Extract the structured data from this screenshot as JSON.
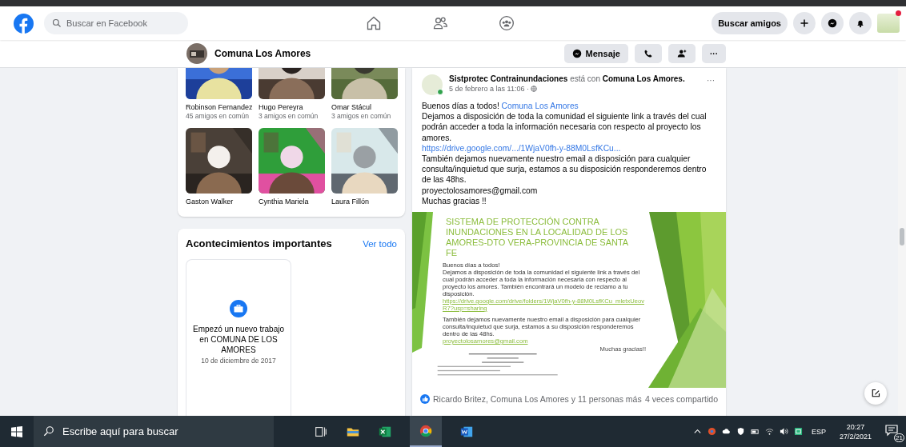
{
  "header": {
    "search_placeholder": "Buscar en Facebook",
    "find_friends": "Buscar amigos"
  },
  "page_bar": {
    "name": "Comuna Los Amores",
    "message": "Mensaje",
    "more": "···"
  },
  "friends": [
    {
      "name": "Robinson Fernandez",
      "mutual": "45 amigos en común"
    },
    {
      "name": "Hugo Pereyra",
      "mutual": "3 amigos en común"
    },
    {
      "name": "Omar Stácul",
      "mutual": "3 amigos en común"
    },
    {
      "name": "Gaston Walker"
    },
    {
      "name": "Cynthia Mariela"
    },
    {
      "name": "Laura Fillón"
    }
  ],
  "events": {
    "title": "Acontecimientos importantes",
    "see_all": "Ver todo",
    "items": [
      {
        "text": "Empezó un nuevo trabajo en COMUNA DE LOS AMORES",
        "date": "10 de diciembre de 2017"
      }
    ]
  },
  "post": {
    "author": "Sistprotec Contrainundaciones",
    "with": "está con",
    "tagged": "Comuna Los Amores.",
    "time": "5 de febrero a las 11:06 ·",
    "more": "···",
    "body": [
      {
        "kind": "mention",
        "text": "Buenos días a todos!",
        "link": "Comuna Los Amores"
      },
      {
        "kind": "text",
        "text": "Dejamos a disposición de toda la comunidad el siguiente link a través del cual podrán acceder a toda la información necesaria con respecto al proyecto los amores."
      },
      {
        "kind": "link",
        "text": "https://drive.google.com/.../1WjaV0fh-y-88M0LsfKCu..."
      },
      {
        "kind": "text",
        "text": "También dejamos nuevamente nuestro email a disposición para cualquier consulta/inquietud que surja, estamos a su disposición responderemos dentro de las 48hs."
      },
      {
        "kind": "text",
        "text": "proyectolosamores@gmail.com"
      },
      {
        "kind": "text",
        "text": "Muchas gracias !!"
      }
    ],
    "slide": {
      "title": "SISTEMA DE PROTECCIÓN CONTRA INUNDACIONES EN LA LOCALIDAD DE LOS AMORES-DTO VERA-PROVINCIA DE SANTA FE",
      "greeting": "Buenos días a todos!",
      "paragraph": "Dejamos a disposición de toda la comunidad el siguiente link a través del cual podrán acceder a toda la información necesaria con respecto al proyecto los amores. También encontrará un modelo de reclamo a tu disposición.",
      "link": "https://drive.google.com/drive/folders/1WjaV0fh-y-88M0LsfKCu_mletxUeovR7?usp=sharing",
      "paragraph_2": "También dejamos nuevamente nuestro email a disposición para cualquier consulta/inquietud que surja, estamos a su disposición responderemos dentro de las 48hs.",
      "email": "proyectolosamores@gmail.com",
      "thanks": "Muchas gracias!!"
    },
    "reactions": "Ricardo Britez, Comuna Los Amores y 11 personas más",
    "shares": "4 veces compartido"
  },
  "taskbar": {
    "search_placeholder": "Escribe aquí para buscar",
    "language": "ESP",
    "time": "20:27",
    "date": "27/2/2021",
    "notifications": "21"
  }
}
